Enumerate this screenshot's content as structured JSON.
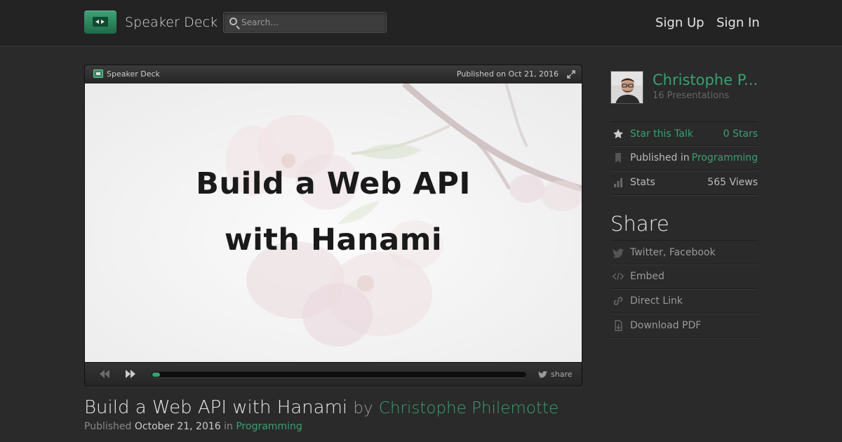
{
  "header": {
    "brand": "Speaker Deck",
    "search_placeholder": "Search...",
    "nav": {
      "sign_up": "Sign Up",
      "sign_in": "Sign In"
    }
  },
  "player": {
    "brand": "Speaker Deck",
    "published": "Published on Oct 21, 2016",
    "slide_lines": [
      "Build a Web API",
      "with Hanami"
    ],
    "share_label": "share",
    "progress_fraction": 0.02
  },
  "talk": {
    "title": "Build a Web API with Hanami",
    "by": "by",
    "author": "Christophe Philemotte",
    "published_label": "Published",
    "published_date": "October 21, 2016",
    "in_label": "in",
    "category": "Programming"
  },
  "sidebar": {
    "author_name": "Christophe P...",
    "presentations": "16 Presentations",
    "star_label": "Star this Talk",
    "stars": "0 Stars",
    "published_in_label": "Published in",
    "published_in_value": "Programming",
    "stats_label": "Stats",
    "stats_value": "565 Views",
    "share_heading": "Share",
    "share_items": [
      "Twitter, Facebook",
      "Embed",
      "Direct Link",
      "Download PDF"
    ]
  },
  "colors": {
    "accent": "#3aa072",
    "background": "#2a2a2a"
  },
  "icons": [
    "search-icon",
    "star-icon",
    "bookmark-icon",
    "bar-chart-icon",
    "twitter-bird-icon",
    "embed-code-icon",
    "link-icon",
    "download-pdf-icon",
    "expand-icon",
    "previous-icon",
    "next-icon"
  ]
}
